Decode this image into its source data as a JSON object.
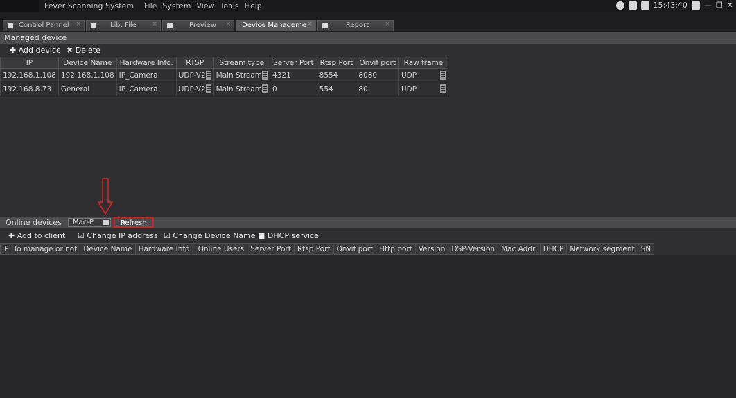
{
  "app_title": "Fever Scanning System",
  "menu": [
    "File",
    "System",
    "View",
    "Tools",
    "Help"
  ],
  "tray": {
    "time": "15:43:40"
  },
  "tabs": [
    {
      "label": "Control Pannel",
      "active": false
    },
    {
      "label": "Lib. File",
      "active": false
    },
    {
      "label": "Preview",
      "active": false
    },
    {
      "label": "Device Manageme",
      "active": true
    },
    {
      "label": "Report",
      "active": false
    }
  ],
  "managed": {
    "title": "Managed device",
    "add_label": "Add device",
    "delete_label": "Delete",
    "columns": [
      "IP",
      "Device Name",
      "Hardware Info.",
      "RTSP",
      "Stream type",
      "Server Port",
      "Rtsp Port",
      "Onvif port",
      "Raw frame"
    ],
    "rows": [
      {
        "ip": "192.168.1.108",
        "name": "192.168.1.108",
        "hw": "IP_Camera",
        "rtsp": "UDP-V2",
        "stream": "Main Stream",
        "server_port": "4321",
        "rtsp_port": "8554",
        "onvif_port": "8080",
        "raw": "UDP"
      },
      {
        "ip": "192.168.8.73",
        "name": "General",
        "hw": "IP_Camera",
        "rtsp": "UDP-V2",
        "stream": "Main Stream",
        "server_port": "0",
        "rtsp_port": "554",
        "onvif_port": "80",
        "raw": "UDP"
      }
    ]
  },
  "online": {
    "title": "Online devices",
    "filter_value": "Mac-P",
    "refresh_label": "Refresh",
    "add_client": "Add to client",
    "change_ip": "Change IP address",
    "change_name": "Change Device Name",
    "dhcp": "DHCP service",
    "columns": [
      "IP",
      "To manage or not",
      "Device Name",
      "Hardware Info.",
      "Online Users",
      "Server Port",
      "Rtsp Port",
      "Onvif port",
      "Http port",
      "Version",
      "DSP-Version",
      "Mac Addr.",
      "DHCP",
      "Network segment",
      "SN"
    ]
  },
  "colors": {
    "accent_highlight": "#d92020",
    "background": "#2f2f31"
  }
}
